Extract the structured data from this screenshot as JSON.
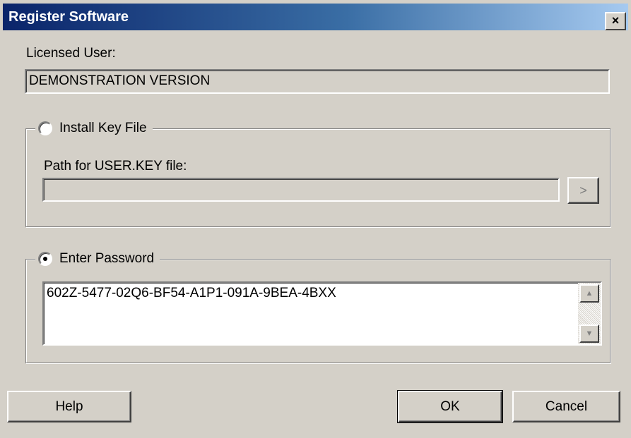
{
  "window": {
    "title": "Register Software",
    "close_glyph": "×"
  },
  "licensed_user": {
    "label": "Licensed User:",
    "value": "DEMONSTRATION VERSION"
  },
  "key_file_group": {
    "option_label": "Install Key File",
    "selected": false,
    "path_label": "Path for USER.KEY file:",
    "path_value": "",
    "browse_glyph": ">"
  },
  "password_group": {
    "option_label": "Enter Password",
    "selected": true,
    "password_value": "602Z-5477-02Q6-BF54-A1P1-091A-9BEA-4BXX",
    "scroll_up_glyph": "▲",
    "scroll_down_glyph": "▼"
  },
  "buttons": {
    "help": "Help",
    "ok": "OK",
    "cancel": "Cancel"
  },
  "colors": {
    "face": "#d4d0c8",
    "title_start": "#0a246a",
    "title_end": "#a6caf0"
  }
}
